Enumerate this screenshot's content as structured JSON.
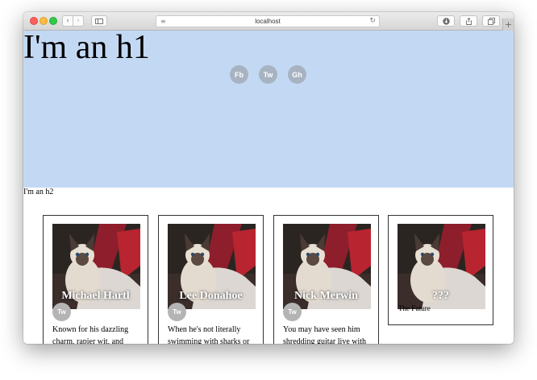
{
  "browser": {
    "url": "localhost"
  },
  "icons": {
    "back": "chevron-left-icon",
    "forward": "chevron-right-icon",
    "sidebar": "sidebar-icon",
    "reader": "reader-view-icon",
    "reload": "reload-icon",
    "download": "download-icon",
    "share": "share-icon",
    "tabs": "tabs-overview-icon",
    "new_tab": "plus-icon"
  },
  "hero": {
    "title": "I'm an h1",
    "social": [
      "Fb",
      "Tw",
      "Gh"
    ],
    "background_color": "#c3d9f3",
    "social_color": "#a8b3c1"
  },
  "section": {
    "subtitle": "I'm an h2"
  },
  "cards": [
    {
      "name": "Michael Hartl",
      "social": "Tw",
      "text": "Known for his dazzling charm, rapier wit, and"
    },
    {
      "name": "Lee Donahoe",
      "social": "Tw",
      "text": "When he's not literally swimming with sharks or"
    },
    {
      "name": "Nick Merwin",
      "social": "Tw",
      "text": "You may have seen him shredding guitar live with"
    },
    {
      "name": "???",
      "subtitle": "The Future"
    }
  ]
}
